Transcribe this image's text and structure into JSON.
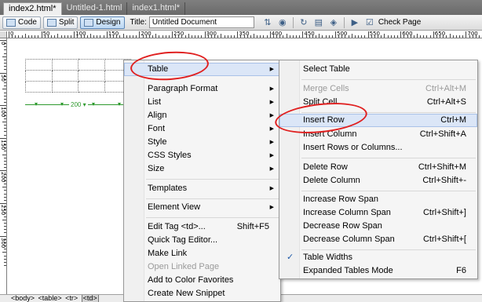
{
  "tabs": [
    "index2.html*",
    "Untitled-1.html",
    "index1.html*"
  ],
  "toolbar": {
    "code_label": "Code",
    "split_label": "Split",
    "design_label": "Design",
    "title_label": "Title:",
    "title_value": "Untitled Document",
    "check_page_label": "Check Page"
  },
  "ruler": {
    "h_labels": [
      "0",
      "50",
      "100",
      "150",
      "200",
      "250",
      "300",
      "350",
      "400",
      "450",
      "500",
      "550",
      "600",
      "650",
      "700"
    ],
    "v_labels": [
      "0",
      "50",
      "100",
      "150",
      "200",
      "250",
      "300"
    ]
  },
  "document": {
    "table_width_label": "200"
  },
  "status_bar": {
    "tags": [
      "<body>",
      "<table>",
      "<tr>"
    ],
    "selected_tag": "<td>"
  },
  "context_menu": {
    "items": [
      {
        "label": "Table",
        "submenu": true,
        "highlighted": true
      },
      {
        "label": "Paragraph Format",
        "submenu": true
      },
      {
        "label": "List",
        "submenu": true
      },
      {
        "label": "Align",
        "submenu": true
      },
      {
        "label": "Font",
        "submenu": true
      },
      {
        "label": "Style",
        "submenu": true
      },
      {
        "label": "CSS Styles",
        "submenu": true
      },
      {
        "label": "Size",
        "submenu": true
      },
      {
        "label": "Templates",
        "submenu": true
      },
      {
        "label": "Element View",
        "submenu": true
      },
      {
        "label": "Edit Tag <td>...",
        "shortcut": "Shift+F5"
      },
      {
        "label": "Quick Tag Editor..."
      },
      {
        "label": "Make Link"
      },
      {
        "label": "Open Linked Page",
        "disabled": true
      },
      {
        "label": "Add to Color Favorites"
      },
      {
        "label": "Create New Snippet"
      }
    ]
  },
  "table_submenu": {
    "items": [
      {
        "label": "Select Table"
      },
      {
        "label": "Merge Cells",
        "shortcut": "Ctrl+Alt+M",
        "disabled": true
      },
      {
        "label": "Split Cell...",
        "shortcut": "Ctrl+Alt+S"
      },
      {
        "label": "Insert Row",
        "shortcut": "Ctrl+M",
        "highlighted": true
      },
      {
        "label": "Insert Column",
        "shortcut": "Ctrl+Shift+A"
      },
      {
        "label": "Insert Rows or Columns..."
      },
      {
        "label": "Delete Row",
        "shortcut": "Ctrl+Shift+M"
      },
      {
        "label": "Delete Column",
        "shortcut": "Ctrl+Shift+-"
      },
      {
        "label": "Increase Row Span"
      },
      {
        "label": "Increase Column Span",
        "shortcut": "Ctrl+Shift+]"
      },
      {
        "label": "Decrease Row Span"
      },
      {
        "label": "Decrease Column Span",
        "shortcut": "Ctrl+Shift+["
      },
      {
        "label": "Table Widths",
        "checked": true
      },
      {
        "label": "Expanded Tables Mode",
        "shortcut": "F6"
      }
    ]
  },
  "colors": {
    "annotation": "#e02020",
    "width_guide": "#2e9a2e",
    "menu_highlight": "#dbe6f7"
  }
}
